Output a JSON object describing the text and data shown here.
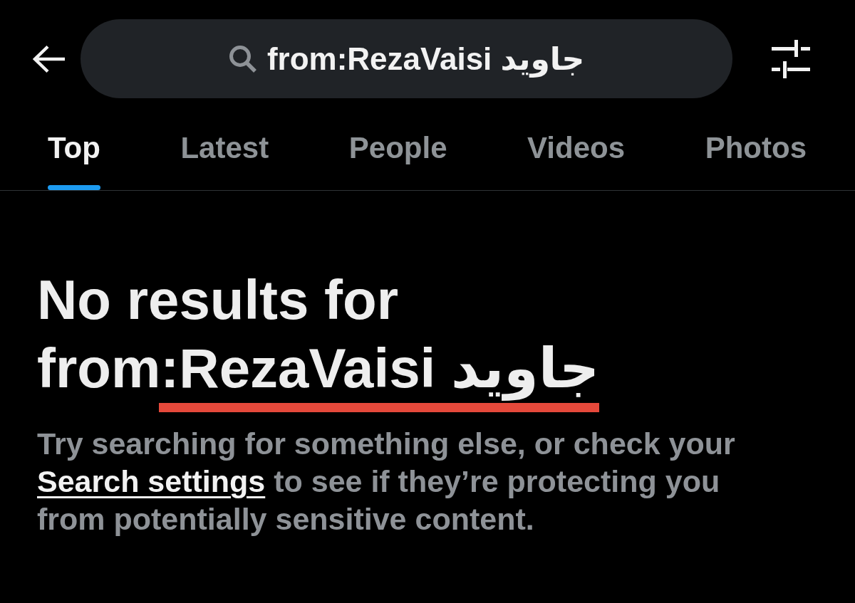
{
  "search": {
    "value": "from:RezaVaisi جاوید"
  },
  "tabs": [
    {
      "label": "Top",
      "selected": true
    },
    {
      "label": "Latest",
      "selected": false
    },
    {
      "label": "People",
      "selected": false
    },
    {
      "label": "Videos",
      "selected": false
    },
    {
      "label": "Photos",
      "selected": false
    }
  ],
  "empty_state": {
    "heading": "No results for from:RezaVaisi جاوید",
    "annotation": {
      "kind": "underline"
    },
    "message": {
      "before": "Try searching for something else, or check your ",
      "link": "Search settings",
      "after": " to see if they’re protecting you from potentially sensitive content."
    }
  }
}
